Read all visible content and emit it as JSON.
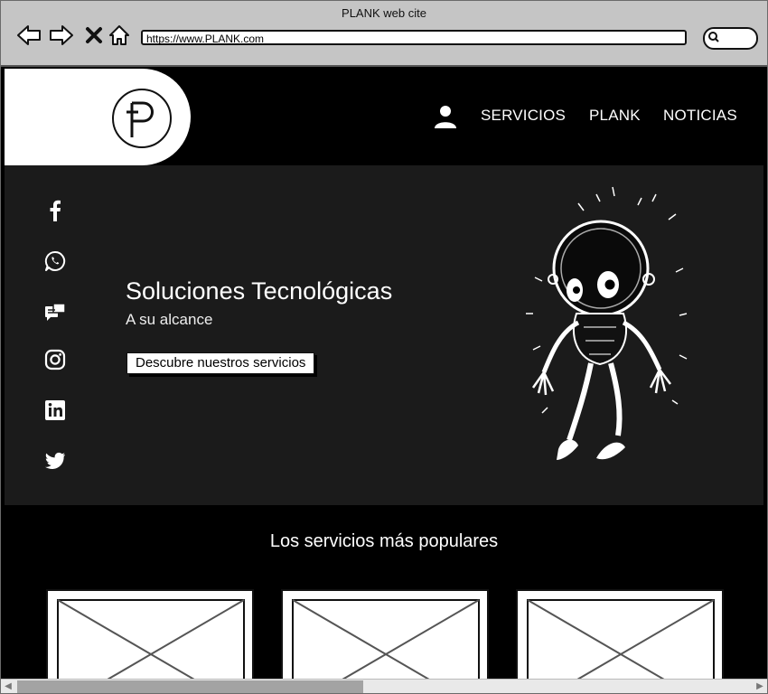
{
  "window": {
    "title": "PLANK web cite"
  },
  "browser": {
    "url": "https://www.PLANK.com"
  },
  "header": {
    "logo_letter": "P",
    "nav": [
      "SERVICIOS",
      "PLANK",
      "NOTICIAS"
    ]
  },
  "social": [
    "facebook-icon",
    "whatsapp-icon",
    "chat-icon",
    "instagram-icon",
    "linkedin-icon",
    "twitter-icon"
  ],
  "hero": {
    "title": "Soluciones Tecnológicas",
    "subtitle": "A su alcance",
    "cta": "Descubre nuestros servicios"
  },
  "services": {
    "title": "Los servicios más populares",
    "cards": [
      {
        "image": "placeholder-image"
      },
      {
        "image": "placeholder-image"
      },
      {
        "image": "placeholder-image"
      }
    ]
  },
  "colors": {
    "background": "#000000",
    "hero": "#1b1b1b",
    "chrome": "#c5c5c5",
    "text": "#ffffff"
  }
}
